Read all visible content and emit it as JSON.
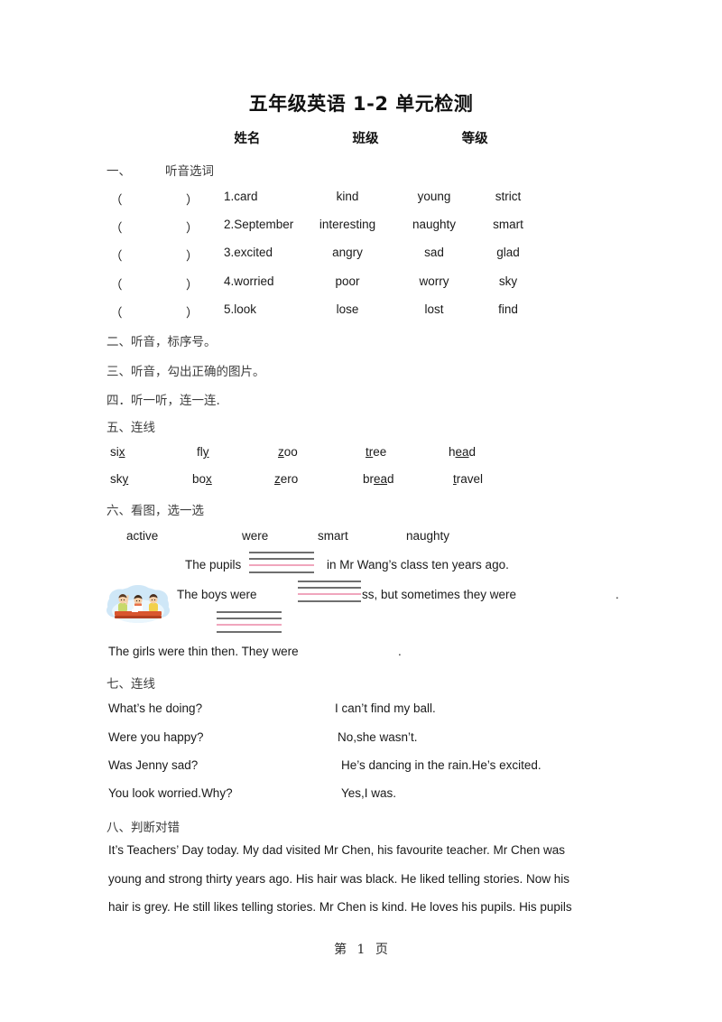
{
  "document": {
    "title": "五年级英语 1-2 单元检测",
    "header_fields": [
      "姓名",
      "班级",
      "等级"
    ],
    "footer": {
      "prefix": "第",
      "page_number": "1",
      "suffix": "页"
    }
  },
  "sections": {
    "s1": {
      "number": "一、",
      "heading": "听音选词",
      "paren_open": "（",
      "paren_close": "）",
      "rows": [
        {
          "stem": "1.card",
          "options": [
            "kind",
            "young",
            "strict"
          ]
        },
        {
          "stem": "2.September",
          "options": [
            "interesting",
            "naughty",
            "smart"
          ]
        },
        {
          "stem": "3.excited",
          "options": [
            "angry",
            "sad",
            "glad"
          ]
        },
        {
          "stem": "4.worried",
          "options": [
            "poor",
            "worry",
            "sky"
          ]
        },
        {
          "stem": "5.look",
          "options": [
            "lose",
            "lost",
            "find"
          ]
        }
      ]
    },
    "s2": {
      "heading": "二、听音，标序号。"
    },
    "s3": {
      "heading": "三、听音，勾出正确的图片。"
    },
    "s4": {
      "heading": "四．听一听，连一连."
    },
    "s5": {
      "heading": "五、连线",
      "row1": [
        {
          "pre": "si",
          "mark": "x",
          "post": ""
        },
        {
          "pre": "fl",
          "mark": "y",
          "post": ""
        },
        {
          "pre": "",
          "mark": "z",
          "post": "oo"
        },
        {
          "pre": "",
          "mark": "tr",
          "post": "ee"
        },
        {
          "pre": "h",
          "mark": "ea",
          "post": "d"
        }
      ],
      "row2": [
        {
          "pre": "sk",
          "mark": "y",
          "post": ""
        },
        {
          "pre": "bo",
          "mark": "x",
          "post": ""
        },
        {
          "pre": "",
          "mark": "z",
          "post": "ero"
        },
        {
          "pre": "br",
          "mark": "ea",
          "post": "d"
        },
        {
          "pre": "",
          "mark": "t",
          "post": "ravel"
        }
      ]
    },
    "s6": {
      "heading": "六、看图，选一选",
      "word_bank": [
        "active",
        "were",
        "smart",
        "naughty"
      ],
      "sentence1_a": "The pupils",
      "sentence1_b": "in Mr Wang’s class ten years ago.",
      "sentence2_a": "The boys were",
      "sentence2_b": "ss, but sometimes they were",
      "sentence2_end": ".",
      "sentence3_a": "The girls were thin then. They were",
      "sentence3_end": ".",
      "image_alt": "boys-in-classroom-clipart"
    },
    "s7": {
      "heading": "七、连线",
      "pairs": [
        {
          "left": "What’s he doing?",
          "right": "I can’t find my ball."
        },
        {
          "left": "Were you happy?",
          "right": "No,she wasn’t."
        },
        {
          "left": "Was Jenny sad?",
          "right": "He’s dancing in the rain.He’s excited."
        },
        {
          "left": "You look worried.Why?",
          "right": "Yes,I was."
        }
      ]
    },
    "s8": {
      "heading": "八、判断对错",
      "passage_lines": [
        "It’s Teachers’ Day today. My dad visited Mr Chen, his favourite teacher. Mr Chen was",
        "young and strong thirty years ago. His hair was black. He liked telling stories. Now his",
        "hair is grey. He still likes telling stories. Mr Chen is kind. He loves his pupils. His pupils"
      ]
    }
  },
  "colors": {
    "rule_line": "#6f6f6f",
    "rule_line_pink": "#f0a6bd",
    "text": "#1a1a1a",
    "heading_cn": "#3d3d3d"
  }
}
